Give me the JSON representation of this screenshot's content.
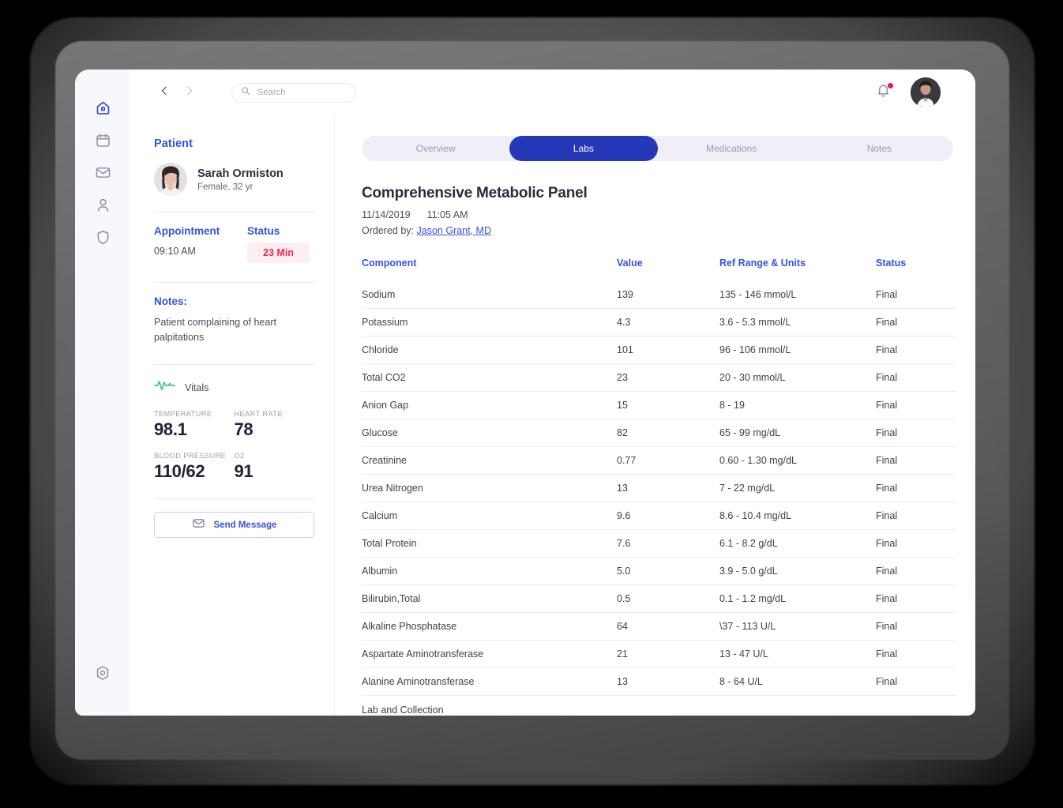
{
  "sidebar": {
    "items": [
      {
        "name": "home",
        "icon": "home-icon",
        "active": true
      },
      {
        "name": "calendar",
        "icon": "calendar-icon",
        "active": false
      },
      {
        "name": "mail",
        "icon": "mail-icon",
        "active": false
      },
      {
        "name": "profile",
        "icon": "user-icon",
        "active": false
      },
      {
        "name": "security",
        "icon": "shield-icon",
        "active": false
      }
    ],
    "bottom": {
      "name": "settings",
      "icon": "settings-icon"
    }
  },
  "header": {
    "back_label": "‹",
    "forward_label": "›",
    "search_placeholder": "Search",
    "search_value": "",
    "notification_icon": "bell-icon",
    "has_notification": true,
    "avatar_alt": "Doctor avatar"
  },
  "patient_panel": {
    "section_label": "Patient",
    "name": "Sarah Ormiston",
    "demographics": "Female, 32 yr",
    "appointment_label": "Appointment",
    "appointment_time": "09:10 AM",
    "status_label": "Status",
    "status_badge": "23 Min",
    "notes_label": "Notes:",
    "notes_text": "Patient complaining of heart palpitations",
    "vitals_label": "Vitals",
    "vitals": [
      {
        "label": "TEMPERATURE",
        "value": "98.1"
      },
      {
        "label": "HEART RATE",
        "value": "78"
      },
      {
        "label": "BLOOD PRESSURE",
        "value": "110/62"
      },
      {
        "label": "O2",
        "value": "91"
      }
    ],
    "send_message_label": "Send Message"
  },
  "main": {
    "tabs": [
      {
        "label": "Overview",
        "active": false
      },
      {
        "label": "Labs",
        "active": true
      },
      {
        "label": "Medications",
        "active": false
      },
      {
        "label": "Notes",
        "active": false
      }
    ],
    "report_title": "Comprehensive Metabolic Panel",
    "report_date": "11/14/2019",
    "report_time": "11:05 AM",
    "ordered_by_label": "Ordered by:",
    "ordered_by_name": "Jason Grant, MD",
    "table": {
      "columns": [
        "Component",
        "Value",
        "Ref Range & Units",
        "Status"
      ],
      "rows": [
        {
          "component": "Sodium",
          "value": "139",
          "ref": "135 - 146 mmol/L",
          "status": "Final"
        },
        {
          "component": "Potassium",
          "value": "4.3",
          "ref": "3.6 - 5.3 mmol/L",
          "status": "Final"
        },
        {
          "component": "Chloride",
          "value": "101",
          "ref": "96 - 106 mmol/L",
          "status": "Final"
        },
        {
          "component": "Total CO2",
          "value": "23",
          "ref": "20 - 30 mmol/L",
          "status": "Final"
        },
        {
          "component": "Anion Gap",
          "value": "15",
          "ref": "8 - 19",
          "status": "Final"
        },
        {
          "component": "Glucose",
          "value": "82",
          "ref": "65 - 99 mg/dL",
          "status": "Final"
        },
        {
          "component": "Creatinine",
          "value": "0.77",
          "ref": "0.60 - 1.30 mg/dL",
          "status": "Final"
        },
        {
          "component": "Urea Nitrogen",
          "value": "13",
          "ref": "7 - 22 mg/dL",
          "status": "Final"
        },
        {
          "component": "Calcium",
          "value": "9.6",
          "ref": "8.6 - 10.4 mg/dL",
          "status": "Final"
        },
        {
          "component": "Total Protein",
          "value": "7.6",
          "ref": "6.1 - 8.2 g/dL",
          "status": "Final"
        },
        {
          "component": "Albumin",
          "value": "5.0",
          "ref": "3.9 - 5.0 g/dL",
          "status": "Final"
        },
        {
          "component": "Bilirubin,Total",
          "value": "0.5",
          "ref": "0.1 - 1.2 mg/dL",
          "status": "Final"
        },
        {
          "component": "Alkaline Phosphatase",
          "value": "64",
          "ref": "\\37 - 113 U/L",
          "status": "Final"
        },
        {
          "component": "Aspartate Aminotransferase",
          "value": "21",
          "ref": "13 - 47 U/L",
          "status": "Final"
        },
        {
          "component": "Alanine Aminotransferase",
          "value": "13",
          "ref": "8 - 64 U/L",
          "status": "Final"
        }
      ],
      "footer_label": "Lab and Collection"
    }
  },
  "colors": {
    "accent_blue": "#3552e0",
    "active_tab_blue": "#2439b8",
    "badge_text": "#f2285a",
    "badge_bg": "#fdeef1",
    "vitals_green": "#3fc87f",
    "notification_dot": "#f3174e"
  }
}
